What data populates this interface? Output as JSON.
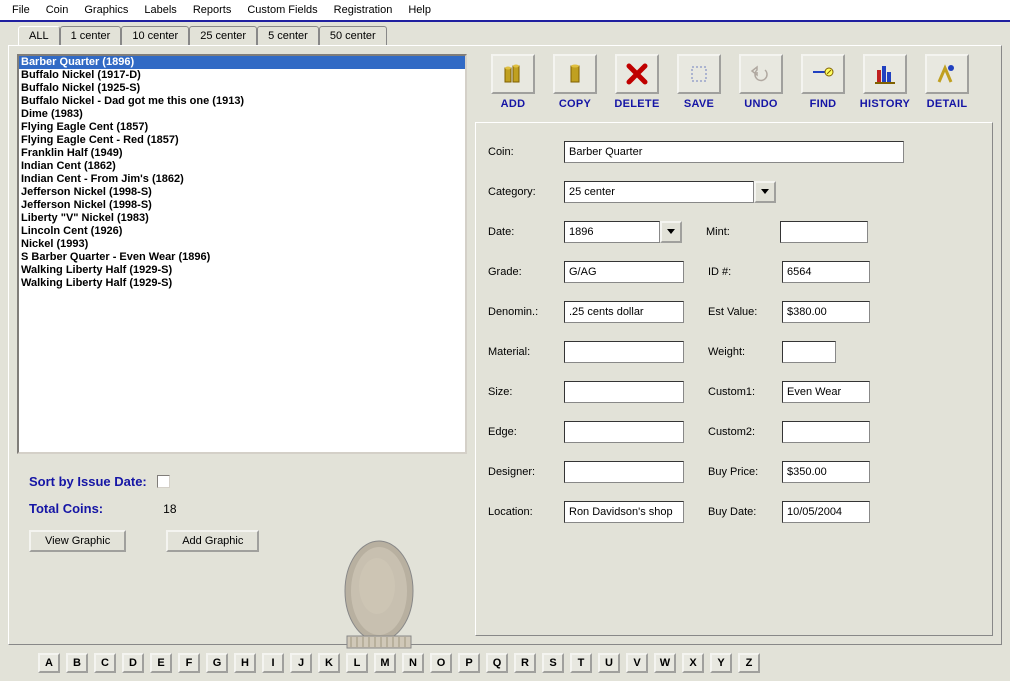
{
  "menu": [
    "File",
    "Coin",
    "Graphics",
    "Labels",
    "Reports",
    "Custom Fields",
    "Registration",
    "Help"
  ],
  "tabs": [
    "ALL",
    "1 center",
    "10 center",
    "25 center",
    "5 center",
    "50 center"
  ],
  "active_tab": 0,
  "list": [
    "Barber Quarter (1896)",
    "Buffalo Nickel (1917-D)",
    "Buffalo Nickel (1925-S)",
    "Buffalo Nickel - Dad got me this one (1913)",
    "Dime (1983)",
    "Flying Eagle Cent (1857)",
    "Flying Eagle Cent - Red (1857)",
    "Franklin Half (1949)",
    "Indian Cent (1862)",
    "Indian Cent - From Jim's (1862)",
    "Jefferson Nickel (1998-S)",
    "Jefferson Nickel (1998-S)",
    "Liberty \"V\" Nickel (1983)",
    "Lincoln Cent (1926)",
    "Nickel (1993)",
    "S Barber Quarter - Even Wear (1896)",
    "Walking Liberty Half (1929-S)",
    "Walking Liberty Half (1929-S)"
  ],
  "selected_index": 0,
  "sort_label": "Sort by Issue Date:",
  "total_label": "Total Coins:",
  "total_value": "18",
  "view_graphic": "View Graphic",
  "add_graphic": "Add Graphic",
  "toolbar": {
    "add": "ADD",
    "copy": "COPY",
    "delete": "DELETE",
    "save": "SAVE",
    "undo": "UNDO",
    "find": "FIND",
    "history": "HISTORY",
    "detail": "DETAIL"
  },
  "form": {
    "coin_lbl": "Coin:",
    "coin": "Barber Quarter",
    "category_lbl": "Category:",
    "category": "25 center",
    "date_lbl": "Date:",
    "date": "1896",
    "mint_lbl": "Mint:",
    "mint": "",
    "grade_lbl": "Grade:",
    "grade": "G/AG",
    "id_lbl": "ID #:",
    "id": "6564",
    "denom_lbl": "Denomin.:",
    "denom": ".25 cents dollar",
    "est_lbl": "Est Value:",
    "est": "$380.00",
    "material_lbl": "Material:",
    "material": "",
    "weight_lbl": "Weight:",
    "weight": "",
    "size_lbl": "Size:",
    "size": "",
    "custom1_lbl": "Custom1:",
    "custom1": "Even Wear",
    "edge_lbl": "Edge:",
    "edge": "",
    "custom2_lbl": "Custom2:",
    "custom2": "",
    "designer_lbl": "Designer:",
    "designer": "",
    "buyprice_lbl": "Buy Price:",
    "buyprice": "$350.00",
    "location_lbl": "Location:",
    "location": "Ron Davidson's shop",
    "buydate_lbl": "Buy Date:",
    "buydate": "10/05/2004"
  },
  "alpha": [
    "A",
    "B",
    "C",
    "D",
    "E",
    "F",
    "G",
    "H",
    "I",
    "J",
    "K",
    "L",
    "M",
    "N",
    "O",
    "P",
    "Q",
    "R",
    "S",
    "T",
    "U",
    "V",
    "W",
    "X",
    "Y",
    "Z"
  ]
}
